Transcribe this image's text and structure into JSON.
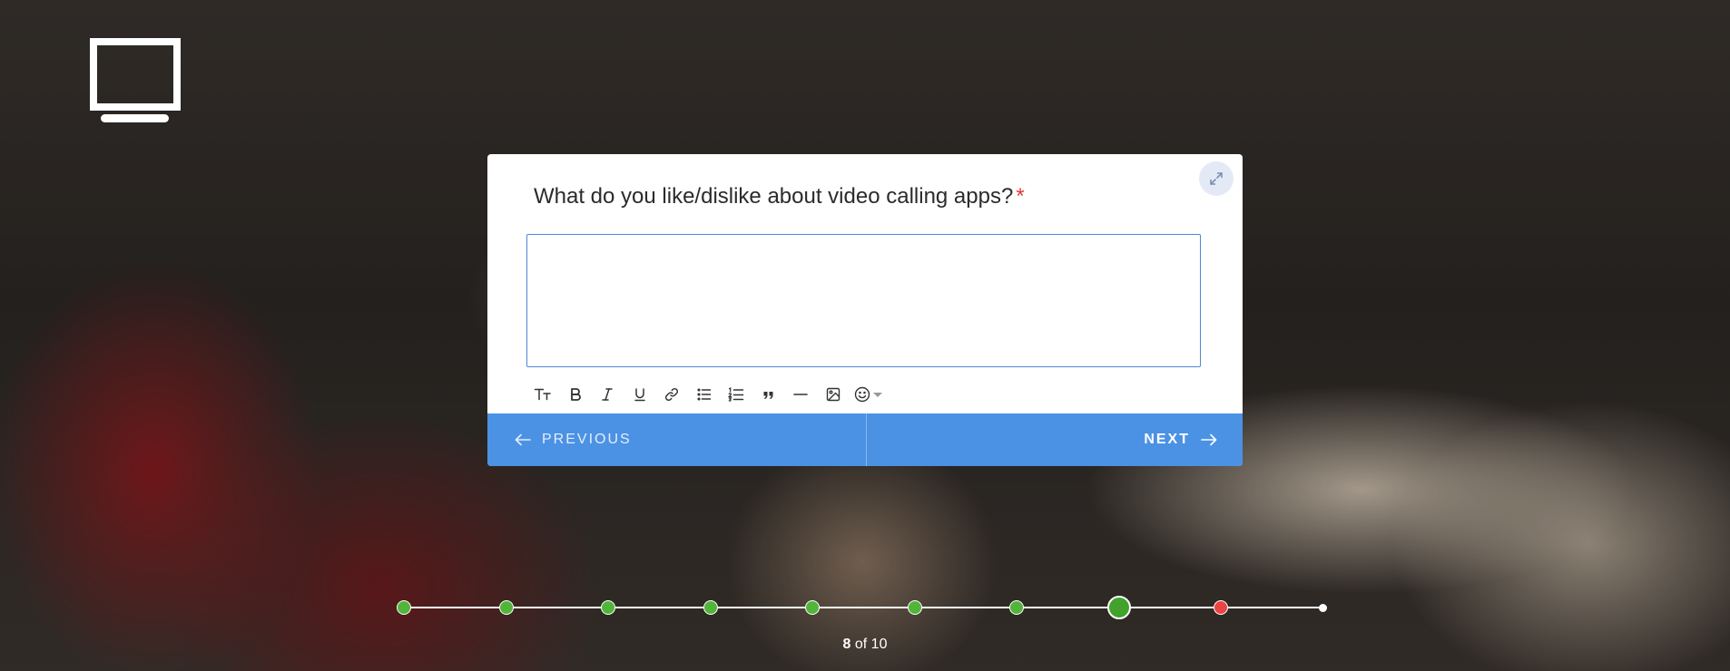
{
  "brand": {
    "logo_icon": "tv-monitor-icon"
  },
  "question": {
    "text": "What do you like/dislike about video calling apps?",
    "required_mark": "*",
    "answer_value": "",
    "expand_icon": "expand-arrows-icon"
  },
  "toolbar": [
    {
      "name": "text-size-icon"
    },
    {
      "name": "bold-icon"
    },
    {
      "name": "italic-icon"
    },
    {
      "name": "underline-icon"
    },
    {
      "name": "link-icon"
    },
    {
      "name": "bulleted-list-icon"
    },
    {
      "name": "numbered-list-icon"
    },
    {
      "name": "blockquote-icon"
    },
    {
      "name": "horizontal-rule-icon"
    },
    {
      "name": "image-icon"
    },
    {
      "name": "emoji-icon"
    }
  ],
  "nav": {
    "previous_label": "PREVIOUS",
    "next_label": "NEXT"
  },
  "progress": {
    "current": "8",
    "separator": " of ",
    "total": "10",
    "steps": [
      {
        "index": 1,
        "status": "complete"
      },
      {
        "index": 2,
        "status": "complete"
      },
      {
        "index": 3,
        "status": "complete"
      },
      {
        "index": 4,
        "status": "complete"
      },
      {
        "index": 5,
        "status": "complete"
      },
      {
        "index": 6,
        "status": "complete"
      },
      {
        "index": 7,
        "status": "complete"
      },
      {
        "index": 8,
        "status": "current"
      },
      {
        "index": 9,
        "status": "error"
      },
      {
        "index": 10,
        "status": "pending"
      }
    ]
  },
  "colors": {
    "accent": "#4b92e4",
    "complete": "#52b53a",
    "error": "#ea4543",
    "required": "#e53935"
  }
}
